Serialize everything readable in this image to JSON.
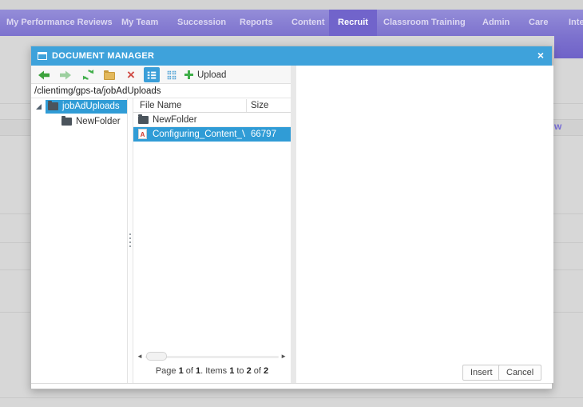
{
  "nav": {
    "items": [
      {
        "label": "My Performance Reviews"
      },
      {
        "label": "My Team"
      },
      {
        "label": "Succession"
      },
      {
        "label": "Reports"
      },
      {
        "label": "Content"
      },
      {
        "label": "Recruit"
      },
      {
        "label": "Classroom Training"
      },
      {
        "label": "Admin"
      },
      {
        "label": "Care"
      },
      {
        "label": "Inte"
      }
    ],
    "active_item": "Recruit"
  },
  "background": {
    "partial_text": "w"
  },
  "dialog": {
    "title": "DOCUMENT MANAGER",
    "close": "×",
    "toolbar": {
      "icons": [
        "back",
        "forward",
        "refresh",
        "new-folder",
        "delete",
        "list-view",
        "grid-view",
        "upload"
      ],
      "delete_glyph": "×",
      "upload_label": "Upload",
      "active_view": "list-view"
    },
    "address": "/clientimg/gps-ta/jobAdUploads",
    "tree": [
      {
        "label": "jobAdUploads",
        "selected": true,
        "expanded": true
      },
      {
        "label": "NewFolder",
        "selected": false
      }
    ],
    "list": {
      "columns": {
        "name": "File Name",
        "size": "Size"
      },
      "rows": [
        {
          "name": "NewFolder",
          "type": "folder",
          "size": "",
          "selected": false
        },
        {
          "name": "Configuring_Content_Vendo",
          "type": "pdf",
          "size": "66797",
          "selected": true
        }
      ],
      "pdf_badge": "A",
      "scroll_left": "◄",
      "scroll_right": "►",
      "pager": {
        "t1": "Page ",
        "n1": "1",
        "t2": " of ",
        "n2": "1",
        "t3": ". Items ",
        "n3": "1",
        "t4": " to ",
        "n4": "2",
        "t5": " of ",
        "n5": "2"
      }
    },
    "buttons": {
      "insert": "Insert",
      "cancel": "Cancel"
    }
  },
  "colors": {
    "titlebar": "#3ea2db",
    "selection": "#309cd6",
    "nav_active": "#7164cb",
    "accent_green": "#3fae49",
    "accent_red": "#cf4a44"
  }
}
